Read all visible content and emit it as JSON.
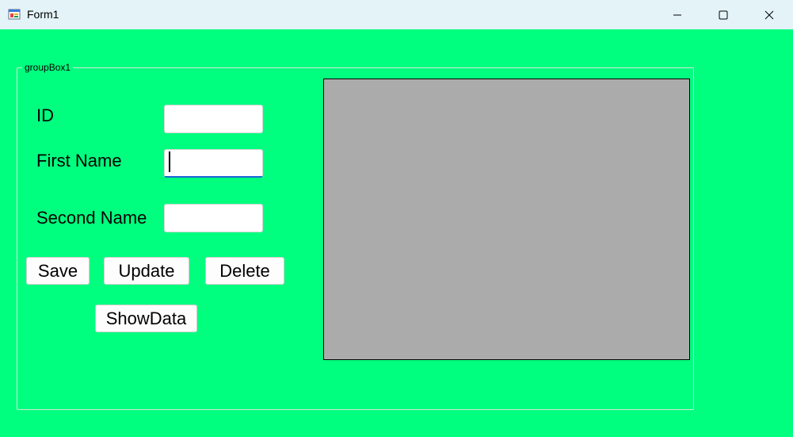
{
  "window": {
    "title": "Form1",
    "icon": "winforms-app-icon",
    "controls": [
      "minimize-icon",
      "maximize-icon",
      "close-icon"
    ]
  },
  "form": {
    "background_color": "#00ff7f",
    "groupbox": {
      "caption": "groupBox1"
    },
    "fields": {
      "id": {
        "label": "ID",
        "value": ""
      },
      "first_name": {
        "label": "First Name",
        "value": ""
      },
      "second_name": {
        "label": "Second Name",
        "value": ""
      }
    },
    "buttons": {
      "save": "Save",
      "update": "Update",
      "delete": "Delete",
      "show_data": "ShowData"
    },
    "data_grid": {
      "background_color": "#ababab",
      "rows": []
    }
  }
}
